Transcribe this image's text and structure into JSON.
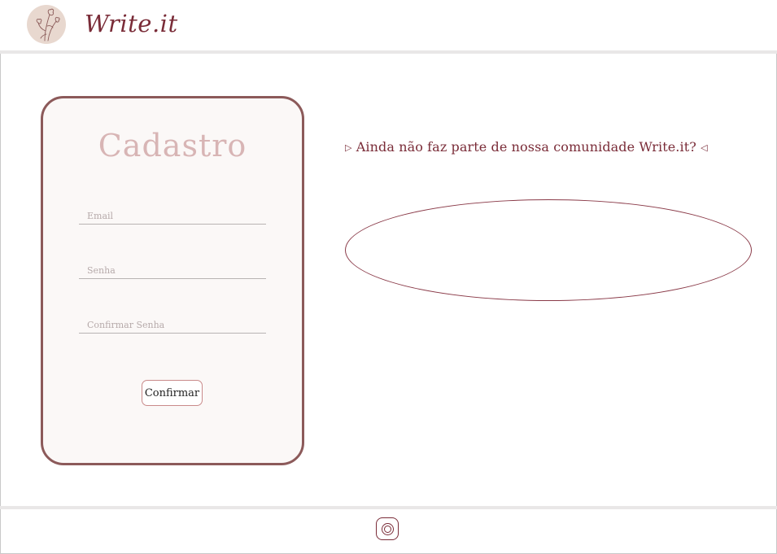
{
  "header": {
    "brand": "Write.it",
    "logo_icon": "flower-logo-icon",
    "logo_bg": "#e8d8cf",
    "brand_color": "#7a2c38"
  },
  "signup": {
    "title": "Cadastro",
    "fields": {
      "email": {
        "placeholder": "Email",
        "value": ""
      },
      "password": {
        "placeholder": "Senha",
        "value": ""
      },
      "confirm_password": {
        "placeholder": "Confirmar Senha",
        "value": ""
      }
    },
    "confirm_label": "Confirmar",
    "border_color": "#8c5a5a",
    "title_color": "#d8b5b5"
  },
  "promo": {
    "left_marker": "▷",
    "text": "Ainda não faz parte de nossa comunidade Write.it?",
    "right_marker": "◁"
  },
  "footer": {
    "social_icon": "instagram-icon"
  }
}
